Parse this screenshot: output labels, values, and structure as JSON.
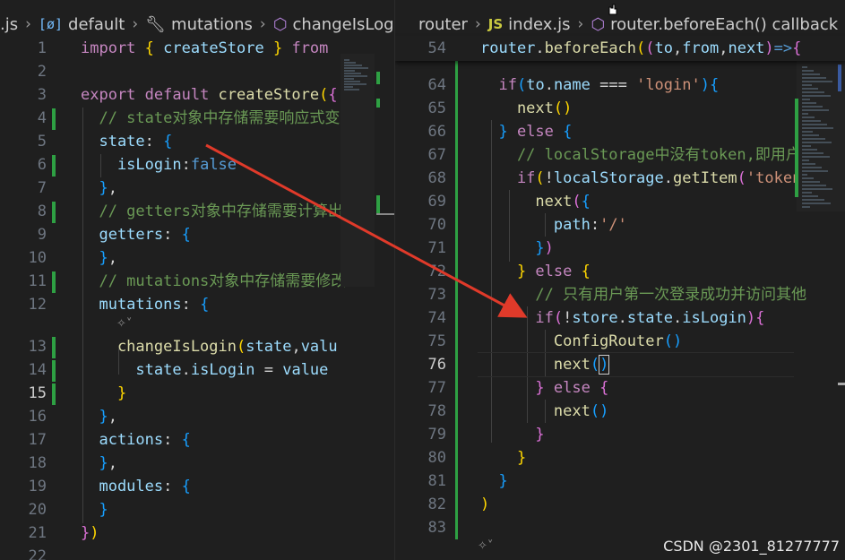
{
  "left_breadcrumb": {
    "file": ".js",
    "items": [
      {
        "icon": "braces-icon",
        "label": "default"
      },
      {
        "icon": "wrench-icon",
        "label": "mutations"
      },
      {
        "icon": "cube-icon",
        "label": "changeIsLogin"
      }
    ]
  },
  "right_breadcrumb": {
    "items": [
      {
        "icon": "",
        "label": "router"
      },
      {
        "icon": "js-icon",
        "label": "index.js"
      },
      {
        "icon": "cube-icon",
        "label": "router.beforeEach() callback"
      }
    ]
  },
  "left_lines": [
    {
      "n": "1",
      "gutter": false,
      "segs": [
        [
          "kw",
          "import "
        ],
        [
          "b1",
          "{ "
        ],
        [
          "vr",
          "createStore"
        ],
        [
          "b1",
          " }"
        ],
        [
          "kw",
          " from "
        ]
      ]
    },
    {
      "n": "2",
      "gutter": false,
      "segs": []
    },
    {
      "n": "3",
      "gutter": false,
      "segs": [
        [
          "kw",
          "export "
        ],
        [
          "kw",
          "default "
        ],
        [
          "fn",
          "createStore"
        ],
        [
          "b1",
          "("
        ],
        [
          "b2",
          "{"
        ]
      ]
    },
    {
      "n": "4",
      "gutter": true,
      "segs": [
        [
          "cm",
          "  // state对象中存储需要响应式变"
        ]
      ]
    },
    {
      "n": "5",
      "gutter": false,
      "segs": [
        [
          "vr",
          "  state"
        ],
        [
          "pl",
          ": "
        ],
        [
          "b3",
          "{"
        ]
      ]
    },
    {
      "n": "6",
      "gutter": true,
      "segs": [
        [
          "vr",
          "    isLogin"
        ],
        [
          "pl",
          ":"
        ],
        [
          "kb",
          "false"
        ]
      ]
    },
    {
      "n": "7",
      "gutter": false,
      "segs": [
        [
          "b3",
          "  }"
        ],
        [
          "pl",
          ","
        ]
      ]
    },
    {
      "n": "8",
      "gutter": true,
      "segs": [
        [
          "cm",
          "  // getters对象中存储需要计算出"
        ]
      ]
    },
    {
      "n": "9",
      "gutter": false,
      "segs": [
        [
          "vr",
          "  getters"
        ],
        [
          "pl",
          ": "
        ],
        [
          "b3",
          "{"
        ]
      ]
    },
    {
      "n": "10",
      "gutter": false,
      "segs": [
        [
          "b3",
          "  }"
        ],
        [
          "pl",
          ","
        ]
      ]
    },
    {
      "n": "11",
      "gutter": true,
      "segs": [
        [
          "cm",
          "  // mutations对象中存储需要修改"
        ]
      ]
    },
    {
      "n": "12",
      "gutter": false,
      "segs": [
        [
          "vr",
          "  mutations"
        ],
        [
          "pl",
          ": "
        ],
        [
          "b3",
          "{"
        ]
      ]
    },
    {
      "n": "13",
      "gutter": true,
      "segs": [
        [
          "fn",
          "    changeIsLogin"
        ],
        [
          "b1",
          "("
        ],
        [
          "vr",
          "state"
        ],
        [
          "pl",
          ","
        ],
        [
          "vr",
          "valu"
        ]
      ]
    },
    {
      "n": "14",
      "gutter": true,
      "segs": [
        [
          "vr",
          "      state"
        ],
        [
          "pl",
          "."
        ],
        [
          "vr",
          "isLogin"
        ],
        [
          "pl",
          " = "
        ],
        [
          "vr",
          "value"
        ]
      ]
    },
    {
      "n": "15",
      "gutter": true,
      "segs": [
        [
          "b1",
          "    }"
        ]
      ]
    },
    {
      "n": "16",
      "gutter": false,
      "segs": [
        [
          "b3",
          "  }"
        ],
        [
          "pl",
          ","
        ]
      ]
    },
    {
      "n": "17",
      "gutter": false,
      "segs": [
        [
          "vr",
          "  actions"
        ],
        [
          "pl",
          ": "
        ],
        [
          "b3",
          "{"
        ]
      ]
    },
    {
      "n": "18",
      "gutter": false,
      "segs": [
        [
          "b3",
          "  }"
        ],
        [
          "pl",
          ","
        ]
      ]
    },
    {
      "n": "19",
      "gutter": false,
      "segs": [
        [
          "vr",
          "  modules"
        ],
        [
          "pl",
          ": "
        ],
        [
          "b3",
          "{"
        ]
      ]
    },
    {
      "n": "20",
      "gutter": false,
      "segs": [
        [
          "b3",
          "  }"
        ]
      ]
    },
    {
      "n": "21",
      "gutter": false,
      "segs": [
        [
          "b2",
          "}"
        ],
        [
          "b1",
          ")"
        ]
      ]
    },
    {
      "n": "22",
      "gutter": false,
      "segs": []
    }
  ],
  "left_active_line": "15",
  "right_sticky": {
    "n": "54",
    "segs": [
      [
        "vr",
        "router"
      ],
      [
        "pl",
        "."
      ],
      [
        "fn",
        "beforeEach"
      ],
      [
        "b1",
        "("
      ],
      [
        "b2",
        "("
      ],
      [
        "vr",
        "to"
      ],
      [
        "pl",
        ","
      ],
      [
        "vr",
        "from"
      ],
      [
        "pl",
        ","
      ],
      [
        "vr",
        "next"
      ],
      [
        "b2",
        ")"
      ],
      [
        "kb",
        "=>"
      ],
      [
        "b2",
        "{"
      ]
    ]
  },
  "right_lines": [
    {
      "n": "64",
      "segs": [
        [
          "kw",
          "  if"
        ],
        [
          "b3",
          "("
        ],
        [
          "vr",
          "to"
        ],
        [
          "pl",
          "."
        ],
        [
          "vr",
          "name"
        ],
        [
          "pl",
          " === "
        ],
        [
          "st",
          "'login'"
        ],
        [
          "b3",
          ")"
        ],
        [
          "b3",
          "{"
        ]
      ]
    },
    {
      "n": "65",
      "segs": [
        [
          "fn",
          "    next"
        ],
        [
          "b1",
          "()"
        ]
      ]
    },
    {
      "n": "66",
      "segs": [
        [
          "b3",
          "  }"
        ],
        [
          "kw",
          " else "
        ],
        [
          "b3",
          "{"
        ]
      ]
    },
    {
      "n": "67",
      "segs": [
        [
          "cm",
          "    // localStorage中没有token,即用户"
        ]
      ]
    },
    {
      "n": "68",
      "segs": [
        [
          "kw",
          "    if"
        ],
        [
          "b1",
          "("
        ],
        [
          "pl",
          "!"
        ],
        [
          "vr",
          "localStorage"
        ],
        [
          "pl",
          "."
        ],
        [
          "fn",
          "getItem"
        ],
        [
          "b2",
          "("
        ],
        [
          "st",
          "'token"
        ]
      ]
    },
    {
      "n": "69",
      "segs": [
        [
          "fn",
          "      next"
        ],
        [
          "b2",
          "("
        ],
        [
          "b3",
          "{"
        ]
      ]
    },
    {
      "n": "70",
      "segs": [
        [
          "vr",
          "        path"
        ],
        [
          "pl",
          ":"
        ],
        [
          "st",
          "'/'"
        ]
      ]
    },
    {
      "n": "71",
      "segs": [
        [
          "b3",
          "      }"
        ],
        [
          "b2",
          ")"
        ]
      ]
    },
    {
      "n": "72",
      "segs": [
        [
          "b1",
          "    }"
        ],
        [
          "kw",
          " else "
        ],
        [
          "b1",
          "{"
        ]
      ]
    },
    {
      "n": "73",
      "segs": [
        [
          "cm",
          "      // 只有用户第一次登录成功并访问其他"
        ]
      ]
    },
    {
      "n": "74",
      "segs": [
        [
          "kw",
          "      if"
        ],
        [
          "b2",
          "("
        ],
        [
          "pl",
          "!"
        ],
        [
          "vr",
          "store"
        ],
        [
          "pl",
          "."
        ],
        [
          "vr",
          "state"
        ],
        [
          "pl",
          "."
        ],
        [
          "vr",
          "isLogin"
        ],
        [
          "b2",
          ")"
        ],
        [
          "b2",
          "{"
        ]
      ]
    },
    {
      "n": "75",
      "segs": [
        [
          "fn",
          "        ConfigRouter"
        ],
        [
          "b3",
          "()"
        ]
      ]
    },
    {
      "n": "76",
      "segs": [
        [
          "fn",
          "        next"
        ],
        [
          "b3",
          "("
        ],
        [
          "b3c",
          ")"
        ]
      ]
    },
    {
      "n": "77",
      "segs": [
        [
          "b2",
          "      }"
        ],
        [
          "kw",
          " else "
        ],
        [
          "b2",
          "{"
        ]
      ]
    },
    {
      "n": "78",
      "segs": [
        [
          "fn",
          "        next"
        ],
        [
          "b3",
          "()"
        ]
      ]
    },
    {
      "n": "79",
      "segs": [
        [
          "b2",
          "      }"
        ]
      ]
    },
    {
      "n": "80",
      "segs": [
        [
          "b1",
          "    }"
        ]
      ]
    },
    {
      "n": "81",
      "segs": [
        [
          "b3",
          "  }"
        ]
      ]
    },
    {
      "n": "82",
      "segs": [
        [
          "b1",
          ")"
        ]
      ]
    },
    {
      "n": "83",
      "segs": []
    }
  ],
  "right_active_line": "76",
  "watermark": "CSDN @2301_81277777",
  "colors": {
    "arrow": "#e03a2a",
    "gutter_added": "#2ea043",
    "background": "#1f1f1f"
  }
}
